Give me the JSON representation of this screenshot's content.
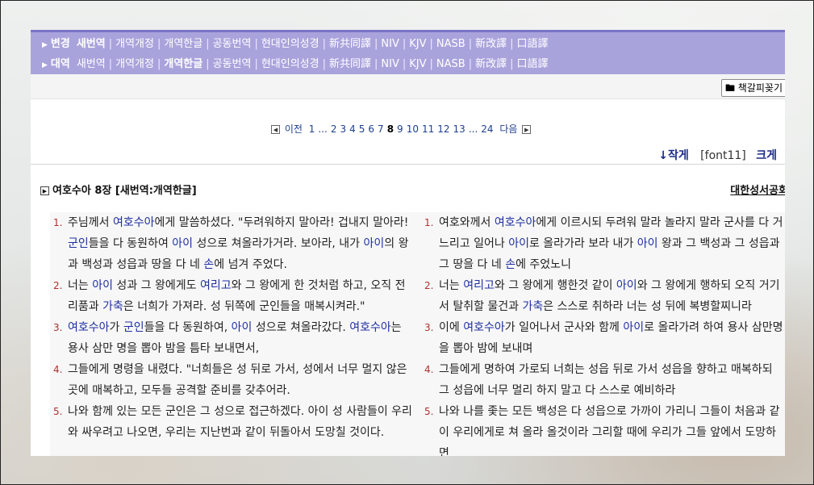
{
  "nav": {
    "row1": {
      "head": "변경",
      "items": [
        "새번역",
        "개역개정",
        "개역한글",
        "공동번역",
        "현대인의성경",
        "新共同譯",
        "NIV",
        "KJV",
        "NASB",
        "新改譯",
        "口語譯"
      ],
      "active_index": 0
    },
    "row2": {
      "head": "대역",
      "items": [
        "새번역",
        "개역개정",
        "개역한글",
        "공동번역",
        "현대인의성경",
        "新共同譯",
        "NIV",
        "KJV",
        "NASB",
        "新改譯",
        "口語譯"
      ],
      "active_index": 2
    }
  },
  "toolbar": {
    "bookmark_label": "책갈피꽂기"
  },
  "pager": {
    "prev": "이전",
    "next": "다음",
    "pages": [
      "1",
      "...",
      "2",
      "3",
      "4",
      "5",
      "6",
      "7",
      "8",
      "9",
      "10",
      "11",
      "12",
      "13",
      "...",
      "24"
    ],
    "current": "8"
  },
  "size": {
    "small": "↓작게",
    "font": "[font11]",
    "large": "크게"
  },
  "chapter": {
    "title": "여호수아 8장 [새번역:개역한글]",
    "society": "대한성서공회"
  },
  "verses_left": [
    {
      "num": "1.",
      "segs": [
        [
          "주님께서 ",
          0
        ],
        [
          "여호수아",
          1
        ],
        [
          "에게 말씀하셨다. \"두려워하지 말아라! 겁내지 말아라! ",
          0
        ],
        [
          "군인",
          1
        ],
        [
          "들을 다 동원하여 ",
          0
        ],
        [
          "아이",
          1
        ],
        [
          " 성으로 쳐올라가거라. 보아라, 내가 ",
          0
        ],
        [
          "아이",
          1
        ],
        [
          "의 왕과 백성과 성읍과 땅을 다 네 ",
          0
        ],
        [
          "손",
          1
        ],
        [
          "에 넘겨 주었다.",
          0
        ]
      ]
    },
    {
      "num": "2.",
      "segs": [
        [
          "너는 ",
          0
        ],
        [
          "아이",
          1
        ],
        [
          " 성과 그 왕에게도 ",
          0
        ],
        [
          "여리고",
          1
        ],
        [
          "와 그 왕에게 한 것처럼 하고, 오직 전리품과 ",
          0
        ],
        [
          "가축",
          1
        ],
        [
          "은 너희가 가져라. 성 뒤쪽에 군인들을 매복시켜라.\"",
          0
        ]
      ]
    },
    {
      "num": "3.",
      "segs": [
        [
          "여호수아",
          1
        ],
        [
          "가 ",
          0
        ],
        [
          "군인",
          1
        ],
        [
          "들을 다 동원하여, ",
          0
        ],
        [
          "아이",
          1
        ],
        [
          " 성으로 쳐올라갔다. ",
          0
        ],
        [
          "여호수아",
          1
        ],
        [
          "는 용사 삼만 명을 뽑아 밤을 틈타 보내면서,",
          0
        ]
      ]
    },
    {
      "num": "4.",
      "segs": [
        [
          "그들에게 명령을 내렸다. \"너희들은 성 뒤로 가서, 성에서 너무 멀지 않은 곳에 매복하고, 모두들 공격할 준비를 갖추어라.",
          0
        ]
      ]
    },
    {
      "num": "5.",
      "segs": [
        [
          "나와 함께 있는 모든 군인은 그 성으로 접근하겠다. 아이 성 사람들이 우리와 싸우려고 나오면, 우리는 지난번과 같이 뒤돌아서 도망칠 것이다.",
          0
        ]
      ]
    }
  ],
  "verses_right": [
    {
      "num": "1.",
      "segs": [
        [
          "여호와께서 ",
          0
        ],
        [
          "여호수아",
          1
        ],
        [
          "에게 이르시되 두려워 말라 놀라지 말라 군사를 다 거느리고 일어나 ",
          0
        ],
        [
          "아이",
          1
        ],
        [
          "로 올라가라 보라 내가 ",
          0
        ],
        [
          "아이",
          1
        ],
        [
          " 왕과 그 백성과 그 성읍과 그 땅을 다 네 ",
          0
        ],
        [
          "손",
          1
        ],
        [
          "에 주었노니",
          0
        ]
      ]
    },
    {
      "num": "2.",
      "segs": [
        [
          "너는 ",
          0
        ],
        [
          "여리고",
          1
        ],
        [
          "와 그 왕에게 행한것 같이 ",
          0
        ],
        [
          "아이",
          1
        ],
        [
          "와 그 왕에게 행하되 오직 거기서 탈취할 물건과 ",
          0
        ],
        [
          "가축",
          1
        ],
        [
          "은 스스로 취하라 너는 성 뒤에 복병할찌니라",
          0
        ]
      ]
    },
    {
      "num": "3.",
      "segs": [
        [
          "이에 ",
          0
        ],
        [
          "여호수아",
          1
        ],
        [
          "가 일어나서 군사와 함께 ",
          0
        ],
        [
          "아이",
          1
        ],
        [
          "로 올라가려 하여 용사 삼만명을 뽑아 밤에 보내며",
          0
        ]
      ]
    },
    {
      "num": "4.",
      "segs": [
        [
          "그들에게 명하여 가로되 너희는 성읍 뒤로 가서 성읍을 향하고 매복하되 그 성읍에 너무 멀리 하지 말고 다 스스로 예비하라",
          0
        ]
      ]
    },
    {
      "num": "5.",
      "segs": [
        [
          "나와 나를 좇는 모든 백성은 다 성읍으로 가까이 가리니 그들이 처음과 같이 우리에게로 쳐 올라 올것이라 그리할 때에 우리가 그들 앞에서 도망하면",
          0
        ]
      ]
    }
  ]
}
